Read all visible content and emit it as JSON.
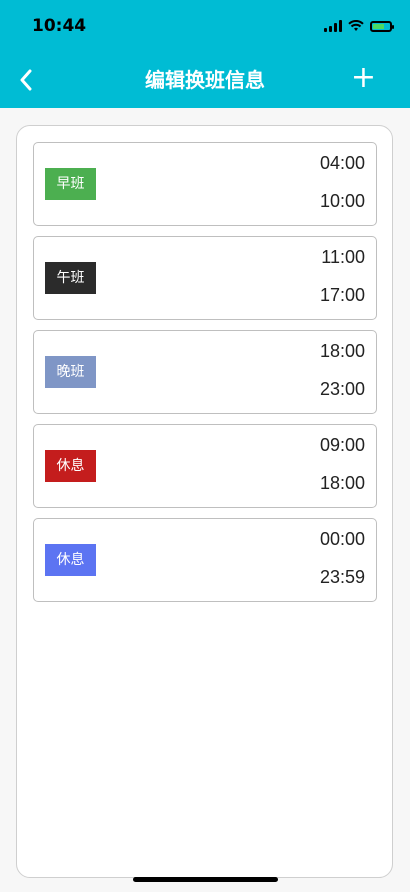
{
  "status": {
    "time": "10:44"
  },
  "nav": {
    "title": "编辑换班信息",
    "add_label": "+"
  },
  "colors": {
    "header": "#00bcd4",
    "shift_0": "#4caf50",
    "shift_1": "#2b2b2b",
    "shift_2": "#7f96c6",
    "shift_3": "#c41d1d",
    "shift_4": "#5c74f2"
  },
  "shifts": [
    {
      "name": "早班",
      "start": "04:00",
      "end": "10:00"
    },
    {
      "name": "午班",
      "start": "11:00",
      "end": "17:00"
    },
    {
      "name": "晚班",
      "start": "18:00",
      "end": "23:00"
    },
    {
      "name": "休息",
      "start": "09:00",
      "end": "18:00"
    },
    {
      "name": "休息",
      "start": "00:00",
      "end": "23:59"
    }
  ]
}
